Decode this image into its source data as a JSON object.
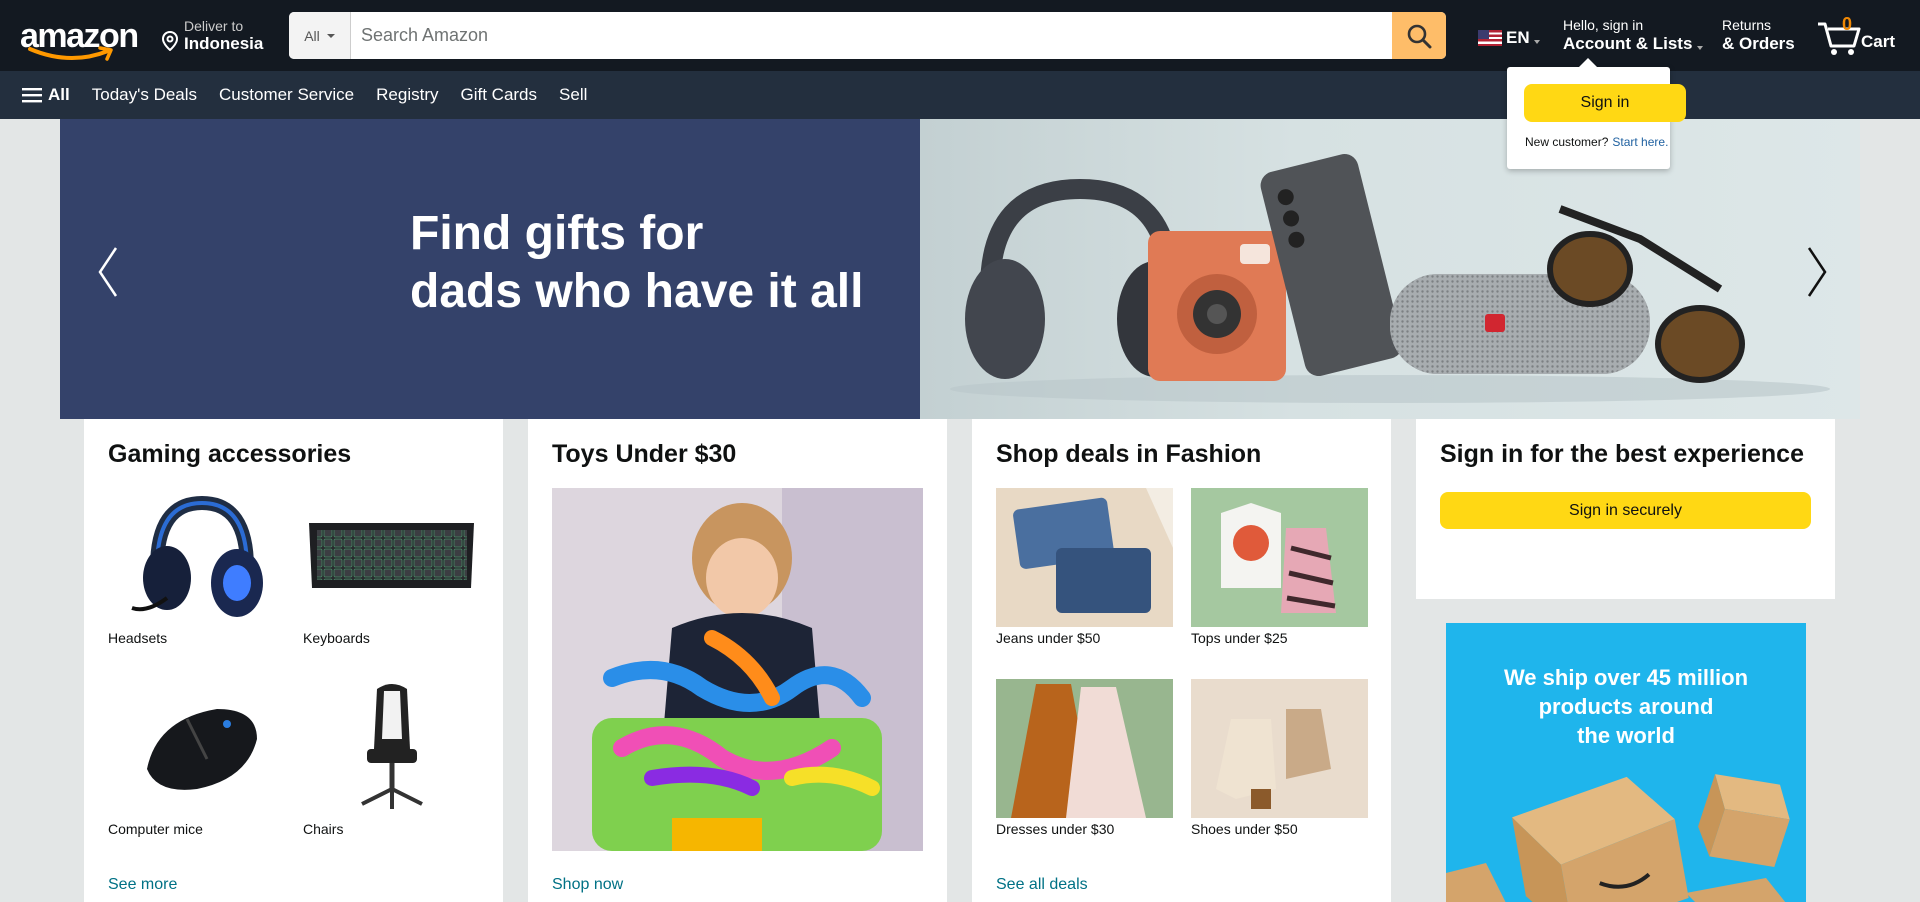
{
  "header": {
    "logo_text": "amazon",
    "deliver_line1": "Deliver to",
    "deliver_line2": "Indonesia",
    "search_category": "All",
    "search_placeholder": "Search Amazon",
    "language": "EN",
    "account_line1": "Hello, sign in",
    "account_line2": "Account & Lists",
    "returns_line1": "Returns",
    "returns_line2": "& Orders",
    "cart_count": "0",
    "cart_label": "Cart"
  },
  "subnav": {
    "all_label": "All",
    "items": [
      "Today's Deals",
      "Customer Service",
      "Registry",
      "Gift Cards",
      "Sell"
    ]
  },
  "popover": {
    "sign_in_label": "Sign in",
    "new_customer_text": "New customer?",
    "start_here_link": "Start here."
  },
  "hero": {
    "title_line1": "Find gifts for",
    "title_line2": "dads who have it all"
  },
  "cards": {
    "gaming": {
      "title": "Gaming accessories",
      "items": [
        "Headsets",
        "Keyboards",
        "Computer mice",
        "Chairs"
      ],
      "link": "See more"
    },
    "toys": {
      "title": "Toys Under $30",
      "link": "Shop now"
    },
    "fashion": {
      "title": "Shop deals in Fashion",
      "items": [
        "Jeans under $50",
        "Tops under $25",
        "Dresses under $30",
        "Shoes under $50"
      ],
      "link": "See all deals"
    },
    "signin": {
      "title": "Sign in for the best experience",
      "button": "Sign in securely"
    },
    "ship": {
      "line1": "We ship over 45 million",
      "line2": "products around",
      "line3": "the world"
    }
  },
  "colors": {
    "nav_dark": "#131921",
    "nav_sub": "#232f3e",
    "search_button": "#febd69",
    "sign_in_button": "#ffd814",
    "link": "#007185",
    "cart_count": "#f08804",
    "hero_left": "#34426a",
    "ship_banner": "#1fb5ec"
  }
}
